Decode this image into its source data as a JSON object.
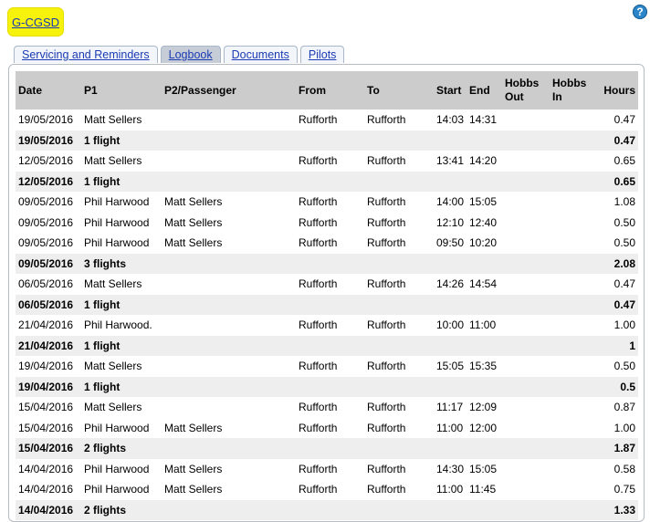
{
  "header": {
    "registration": "G-CGSD",
    "help_icon": "help-icon"
  },
  "tabs": [
    {
      "label": "Servicing and Reminders",
      "active": false
    },
    {
      "label": "Logbook",
      "active": true
    },
    {
      "label": "Documents",
      "active": false
    },
    {
      "label": "Pilots",
      "active": false
    }
  ],
  "logbook": {
    "columns": {
      "date": "Date",
      "p1": "P1",
      "p2": "P2/Passenger",
      "from": "From",
      "to": "To",
      "start": "Start",
      "end": "End",
      "hobbs_out": "Hobbs Out",
      "hobbs_in": "Hobbs In",
      "hours": "Hours"
    },
    "rows": [
      {
        "type": "flight",
        "date": "19/05/2016",
        "p1": "Matt Sellers",
        "p2": "",
        "from": "Rufforth",
        "to": "Rufforth",
        "start": "14:03",
        "end": "14:31",
        "hobbs_out": "",
        "hobbs_in": "",
        "hours": "0.47"
      },
      {
        "type": "summary",
        "date": "19/05/2016",
        "p1": "1 flight",
        "hours": "0.47"
      },
      {
        "type": "flight",
        "date": "12/05/2016",
        "p1": "Matt Sellers",
        "p2": "",
        "from": "Rufforth",
        "to": "Rufforth",
        "start": "13:41",
        "end": "14:20",
        "hobbs_out": "",
        "hobbs_in": "",
        "hours": "0.65"
      },
      {
        "type": "summary",
        "date": "12/05/2016",
        "p1": "1 flight",
        "hours": "0.65"
      },
      {
        "type": "flight",
        "date": "09/05/2016",
        "p1": "Phil Harwood",
        "p2": "Matt Sellers",
        "from": "Rufforth",
        "to": "Rufforth",
        "start": "14:00",
        "end": "15:05",
        "hobbs_out": "",
        "hobbs_in": "",
        "hours": "1.08"
      },
      {
        "type": "flight",
        "date": "09/05/2016",
        "p1": "Phil Harwood",
        "p2": "Matt Sellers",
        "from": "Rufforth",
        "to": "Rufforth",
        "start": "12:10",
        "end": "12:40",
        "hobbs_out": "",
        "hobbs_in": "",
        "hours": "0.50"
      },
      {
        "type": "flight",
        "date": "09/05/2016",
        "p1": "Phil Harwood",
        "p2": "Matt Sellers",
        "from": "Rufforth",
        "to": "Rufforth",
        "start": "09:50",
        "end": "10:20",
        "hobbs_out": "",
        "hobbs_in": "",
        "hours": "0.50"
      },
      {
        "type": "summary",
        "date": "09/05/2016",
        "p1": "3 flights",
        "hours": "2.08"
      },
      {
        "type": "flight",
        "date": "06/05/2016",
        "p1": "Matt Sellers",
        "p2": "",
        "from": "Rufforth",
        "to": "Rufforth",
        "start": "14:26",
        "end": "14:54",
        "hobbs_out": "",
        "hobbs_in": "",
        "hours": "0.47"
      },
      {
        "type": "summary",
        "date": "06/05/2016",
        "p1": "1 flight",
        "hours": "0.47"
      },
      {
        "type": "flight",
        "date": "21/04/2016",
        "p1": "Phil Harwood.",
        "p2": "",
        "from": "Rufforth",
        "to": "Rufforth",
        "start": "10:00",
        "end": "11:00",
        "hobbs_out": "",
        "hobbs_in": "",
        "hours": "1.00"
      },
      {
        "type": "summary",
        "date": "21/04/2016",
        "p1": "1 flight",
        "hours": "1"
      },
      {
        "type": "flight",
        "date": "19/04/2016",
        "p1": "Matt Sellers",
        "p2": "",
        "from": "Rufforth",
        "to": "Rufforth",
        "start": "15:05",
        "end": "15:35",
        "hobbs_out": "",
        "hobbs_in": "",
        "hours": "0.50"
      },
      {
        "type": "summary",
        "date": "19/04/2016",
        "p1": "1 flight",
        "hours": "0.5"
      },
      {
        "type": "flight",
        "date": "15/04/2016",
        "p1": "Matt Sellers",
        "p2": "",
        "from": "Rufforth",
        "to": "Rufforth",
        "start": "11:17",
        "end": "12:09",
        "hobbs_out": "",
        "hobbs_in": "",
        "hours": "0.87"
      },
      {
        "type": "flight",
        "date": "15/04/2016",
        "p1": "Phil Harwood",
        "p2": "Matt Sellers",
        "from": "Rufforth",
        "to": "Rufforth",
        "start": "11:00",
        "end": "12:00",
        "hobbs_out": "",
        "hobbs_in": "",
        "hours": "1.00"
      },
      {
        "type": "summary",
        "date": "15/04/2016",
        "p1": "2 flights",
        "hours": "1.87"
      },
      {
        "type": "flight",
        "date": "14/04/2016",
        "p1": "Phil Harwood",
        "p2": "Matt Sellers",
        "from": "Rufforth",
        "to": "Rufforth",
        "start": "14:30",
        "end": "15:05",
        "hobbs_out": "",
        "hobbs_in": "",
        "hours": "0.58"
      },
      {
        "type": "flight",
        "date": "14/04/2016",
        "p1": "Phil Harwood",
        "p2": "Matt Sellers",
        "from": "Rufforth",
        "to": "Rufforth",
        "start": "11:00",
        "end": "11:45",
        "hobbs_out": "",
        "hobbs_in": "",
        "hours": "0.75"
      },
      {
        "type": "summary",
        "date": "14/04/2016",
        "p1": "2 flights",
        "hours": "1.33"
      }
    ]
  },
  "colors": {
    "badge_bg": "#f7f20c",
    "link": "#1a3bb3",
    "header_bg": "#cccccc",
    "summary_bg": "#eeeeee",
    "help_icon_bg": "#2a86c8"
  }
}
